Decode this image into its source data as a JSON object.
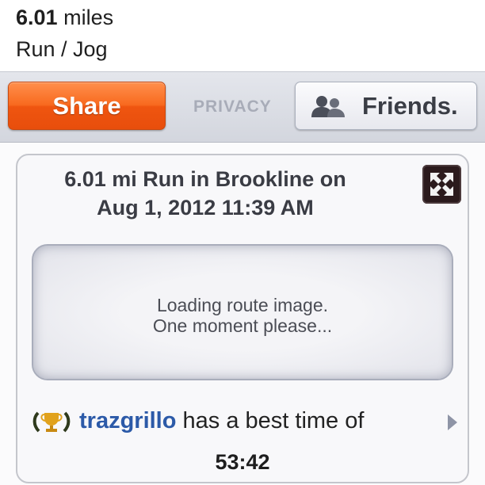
{
  "summary": {
    "distance_value": "6.01",
    "distance_unit": "miles",
    "activity_type": "Run / Jog"
  },
  "share_bar": {
    "share_label": "Share",
    "privacy_label": "PRIVACY",
    "friends_label": "Friends.",
    "friends_icon": "people-icon"
  },
  "card": {
    "title_line1": "6.01 mi Run in Brookline on",
    "title_line2": "Aug 1, 2012 11:39 AM",
    "expand_icon": "expand-arrows-icon",
    "route_loading_line1": "Loading route image.",
    "route_loading_line2": "One moment please...",
    "best": {
      "trophy_icon": "trophy-laurel-icon",
      "user": "trazgrillo",
      "text": "has a best time of",
      "time": "53:42",
      "chevron_icon": "chevron-right-icon"
    }
  },
  "colors": {
    "share_orange": "#f86a1f",
    "user_link_blue": "#2c5aa8",
    "privacy_gray": "#a8acb8"
  }
}
